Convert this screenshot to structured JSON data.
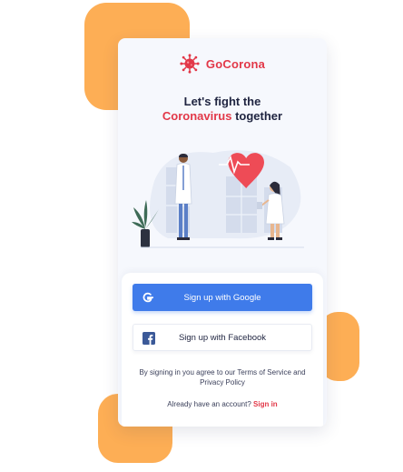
{
  "app": {
    "name": "GoCorona"
  },
  "headline": {
    "line1": "Let's fight the",
    "accent": "Coronavirus",
    "rest": " together"
  },
  "buttons": {
    "google_label": "Sign up with Google",
    "facebook_label": "Sign up with Facebook"
  },
  "terms": {
    "text": "By signing in you agree to our Terms of Service and Privacy Policy"
  },
  "account": {
    "prompt": "Already have an account? ",
    "link": "Sign in"
  },
  "colors": {
    "brand": "#E23848",
    "google": "#3F7BEA",
    "blob": "#FDAE55",
    "bg": "#F6F8FD"
  },
  "icons": {
    "logo": "virus-icon",
    "google": "google-g-icon",
    "facebook": "facebook-f-icon"
  }
}
